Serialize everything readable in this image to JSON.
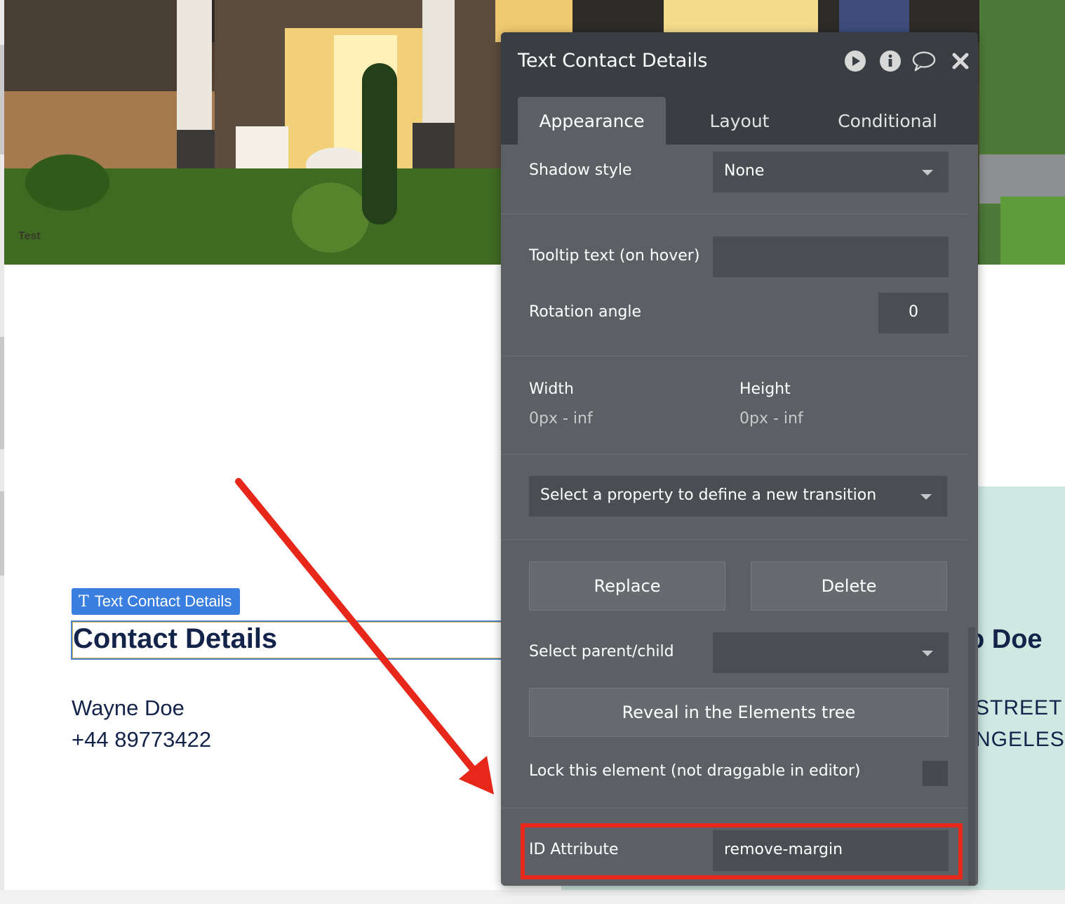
{
  "hero": {
    "caption": "Test"
  },
  "canvas": {
    "tag_label": "Text Contact Details",
    "heading": "Contact Details",
    "contact_name": "Wayne Doe",
    "contact_phone": "+44 89773422",
    "right_name_partial": "o Doe",
    "right_line1_partial": "STREET",
    "right_line2_partial": "NGELES"
  },
  "panel": {
    "title": "Text Contact Details",
    "header_icons": [
      "play-icon",
      "info-icon",
      "comment-icon",
      "close-icon"
    ],
    "tabs": [
      {
        "label": "Appearance",
        "active": true
      },
      {
        "label": "Layout",
        "active": false
      },
      {
        "label": "Conditional",
        "active": false
      }
    ],
    "shadow_style": {
      "label": "Shadow style",
      "value": "None"
    },
    "tooltip": {
      "label": "Tooltip text (on hover)",
      "value": ""
    },
    "rotation": {
      "label": "Rotation angle",
      "value": "0"
    },
    "width": {
      "label": "Width",
      "value": "0px - inf"
    },
    "height": {
      "label": "Height",
      "value": "0px - inf"
    },
    "transition_placeholder": "Select a property to define a new transition",
    "replace_label": "Replace",
    "delete_label": "Delete",
    "parent_child": {
      "label": "Select parent/child",
      "value": ""
    },
    "reveal_label": "Reveal in the Elements tree",
    "lock": {
      "label": "Lock this element (not draggable in editor)",
      "checked": false
    },
    "id_attribute": {
      "label": "ID Attribute",
      "value": "remove-margin"
    }
  },
  "colors": {
    "panel_bg": "#5c6064",
    "panel_header": "#3a3d41",
    "field_bg": "#4a4e52",
    "tag_blue": "#3a7fe0",
    "heading_navy": "#14234a",
    "mint": "#cfe8e2",
    "annotation_red": "#e8271b"
  }
}
